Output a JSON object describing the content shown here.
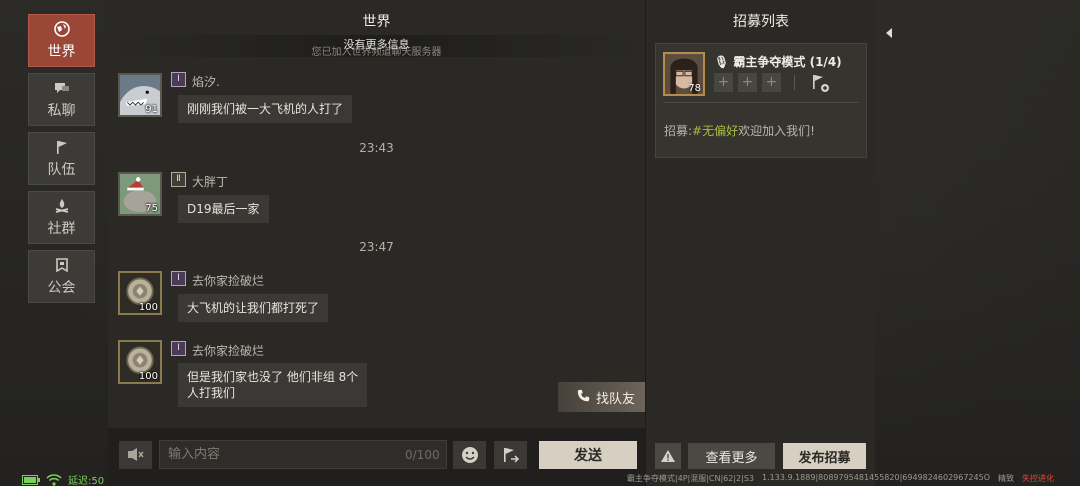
{
  "nav": {
    "items": [
      {
        "label": "世界",
        "icon": "globe-icon"
      },
      {
        "label": "私聊",
        "icon": "chat-bubbles-icon"
      },
      {
        "label": "队伍",
        "icon": "flag-icon"
      },
      {
        "label": "社群",
        "icon": "campfire-icon"
      },
      {
        "label": "公会",
        "icon": "banner-icon"
      }
    ]
  },
  "chat": {
    "title": "世界",
    "no_more": "没有更多信息",
    "joined_notice": "您已加入世界频道聊天服务器",
    "messages": [
      {
        "name": "焰汐.",
        "level": "91",
        "text": "刚刚我们被一大飞机的人打了"
      },
      {
        "time": "23:43"
      },
      {
        "name": "大胖丁",
        "level": "75",
        "text": "D19最后一家"
      },
      {
        "time": "23:47"
      },
      {
        "name": "去你家捡破烂",
        "level": "100",
        "text": "大飞机的让我们都打死了"
      },
      {
        "name": "去你家捡破烂",
        "level": "100",
        "text_line1": "但是我们家也没了 他们非组 8个",
        "text_line2": "人打我们"
      }
    ],
    "find_team": "找队友",
    "input_placeholder": "输入内容",
    "char_count": "0/100",
    "send": "发送"
  },
  "recruit": {
    "title": "招募列表",
    "leader_level": "78",
    "mode": "霸主争夺模式 (1/4)",
    "slots": [
      "+",
      "+",
      "+"
    ],
    "text_prefix": "招募:",
    "text_tag": "#无偏好",
    "text_suffix": "欢迎加入我们!",
    "more": "查看更多",
    "publish": "发布招募"
  },
  "status": {
    "latency": "延迟:50",
    "server_info": "霸主争夺模式|4P|混服|CN|62|2|S3",
    "version": "1.133.9.1889|8089795481455820|6949824602967245O",
    "extra1": "精致",
    "extra2": "失控进化"
  },
  "colors": {
    "active_tab": "#9a4737",
    "accent_green": "#a9bd41",
    "send_button": "#d7cfc2"
  }
}
